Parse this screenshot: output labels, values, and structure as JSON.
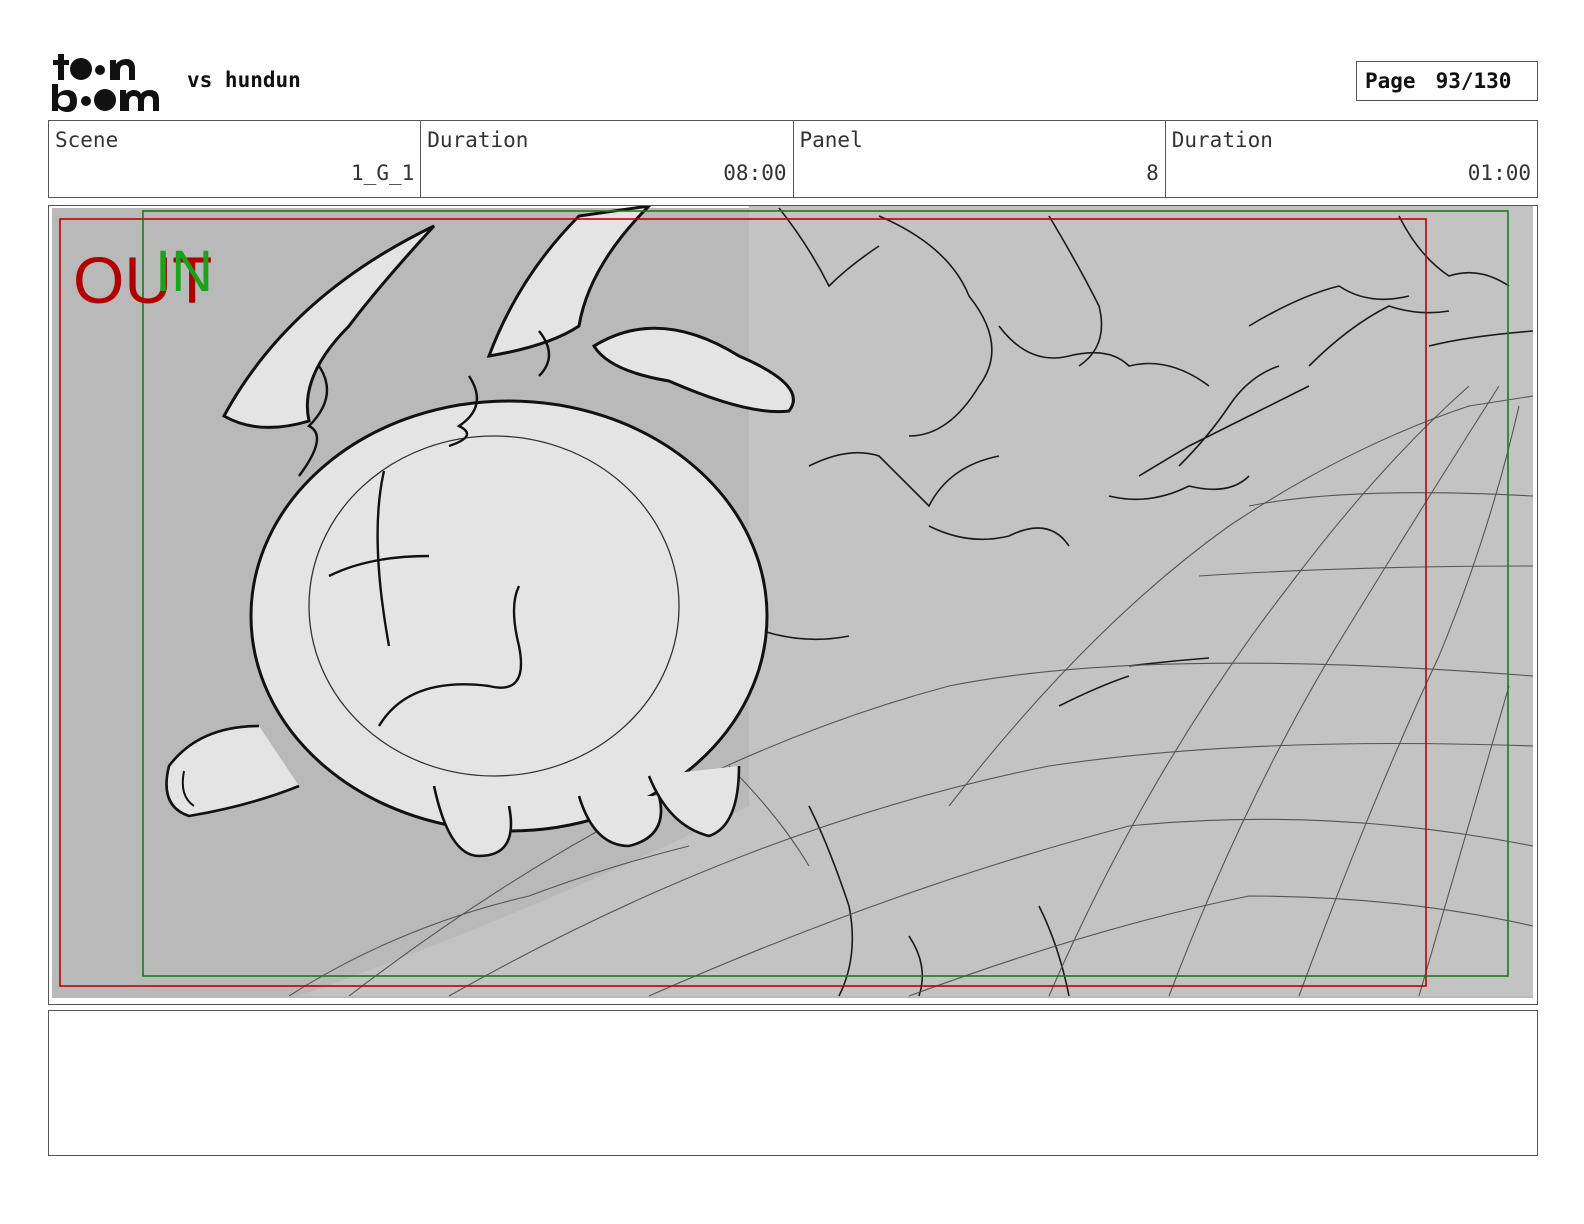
{
  "header": {
    "logo_text": "toon boom",
    "project_title": "vs hundun",
    "page_label": "Page",
    "page_number": "93/130"
  },
  "info_bar": {
    "scene_label": "Scene",
    "scene_value": "1_G_1",
    "scene_duration_label": "Duration",
    "scene_duration_value": "08:00",
    "panel_label": "Panel",
    "panel_value": "8",
    "panel_duration_label": "Duration",
    "panel_duration_value": "01:00"
  },
  "panel_overlay": {
    "out_label": "OUT",
    "in_label": "IN",
    "out_color": "#b00000",
    "in_color": "#1aa31a"
  },
  "notes": {
    "text": ""
  }
}
